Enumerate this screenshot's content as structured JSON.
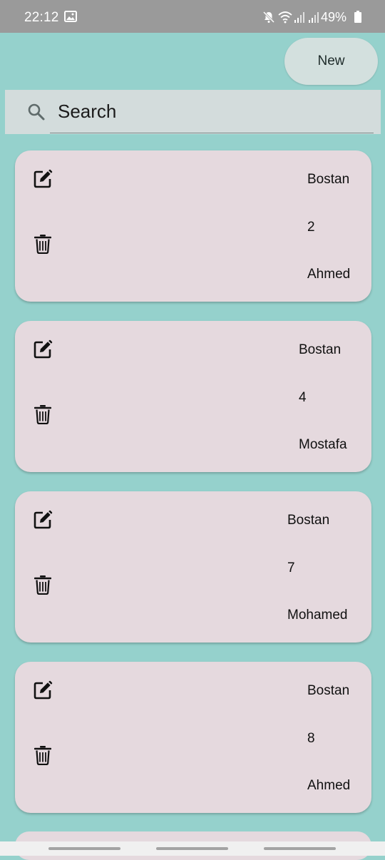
{
  "status_bar": {
    "time": "22:12",
    "battery_text": "49%",
    "icons": [
      "gallery-notification-icon",
      "mute-icon",
      "wifi-icon",
      "signal-icon",
      "signal-icon",
      "battery-icon"
    ]
  },
  "toolbar": {
    "new_label": "New"
  },
  "search": {
    "placeholder": "Search",
    "icon": "search-icon"
  },
  "cards": [
    {
      "title": "Bostan",
      "count": "2",
      "person": "Ahmed"
    },
    {
      "title": "Bostan",
      "count": "4",
      "person": "Mostafa"
    },
    {
      "title": "Bostan",
      "count": "7",
      "person": "Mohamed"
    },
    {
      "title": "Bostan",
      "count": "8",
      "person": "Ahmed"
    }
  ],
  "colors": {
    "background": "#95d1cc",
    "card": "#e5d9de",
    "button": "#d3e0de",
    "search_bar": "#d3dcdc",
    "status_bar": "#9a9a9a"
  }
}
